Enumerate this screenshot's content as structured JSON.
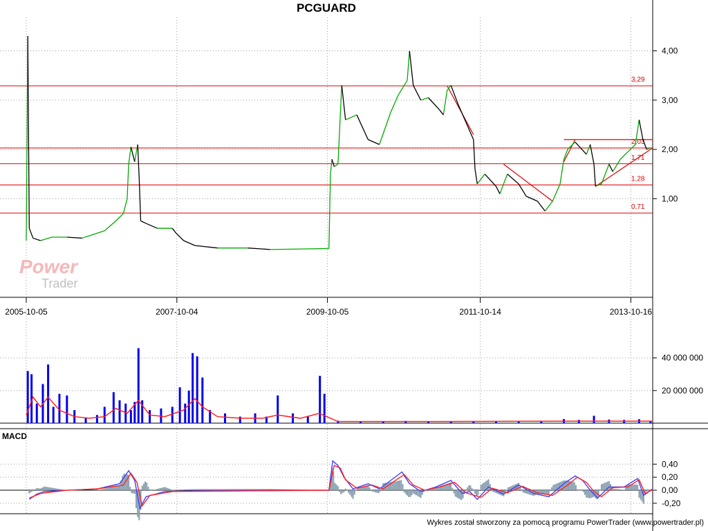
{
  "chart_data": [
    {
      "type": "line",
      "title": "PCGUARD",
      "x_tick_labels": [
        "2005-10-05",
        "2007-10-04",
        "2009-10-05",
        "2011-10-14",
        "2013-10-16"
      ],
      "x_tick_years": [
        2005.76,
        2007.76,
        2009.76,
        2011.79,
        2013.79
      ],
      "x_range": [
        2005.76,
        2014.08
      ],
      "y_ticks": [
        1,
        2,
        3,
        4
      ],
      "y_tick_labels": [
        "1,00",
        "2,00",
        "3,00",
        "4,00"
      ],
      "ylim": [
        -1.0,
        4.4
      ],
      "grid": true,
      "price_color": "#000000",
      "up_color": "#00aa00",
      "level_color": "#dd0000",
      "levels": [
        {
          "value": 3.29,
          "label": "3,29"
        },
        {
          "value": 2.03,
          "label": "2,03"
        },
        {
          "value": 1.71,
          "label": "1,71"
        },
        {
          "value": 1.28,
          "label": "1,28"
        },
        {
          "value": 0.71,
          "label": "0,71"
        }
      ],
      "series": [
        {
          "values": [
            [
              2005.76,
              0.15
            ],
            [
              2005.78,
              4.3
            ],
            [
              2005.8,
              0.4
            ],
            [
              2005.85,
              0.2
            ],
            [
              2005.95,
              0.15
            ],
            [
              2006.1,
              0.22
            ],
            [
              2006.3,
              0.22
            ],
            [
              2006.5,
              0.2
            ],
            [
              2006.6,
              0.25
            ],
            [
              2006.8,
              0.35
            ],
            [
              2006.95,
              0.55
            ],
            [
              2007.05,
              0.7
            ],
            [
              2007.1,
              1.0
            ],
            [
              2007.12,
              1.7
            ],
            [
              2007.15,
              2.05
            ],
            [
              2007.2,
              1.75
            ],
            [
              2007.24,
              2.1
            ],
            [
              2007.26,
              1.4
            ],
            [
              2007.28,
              0.55
            ],
            [
              2007.35,
              0.5
            ],
            [
              2007.5,
              0.4
            ],
            [
              2007.7,
              0.4
            ],
            [
              2007.75,
              0.3
            ],
            [
              2007.85,
              0.15
            ],
            [
              2008.0,
              0.05
            ],
            [
              2008.3,
              0.0
            ],
            [
              2008.7,
              0.0
            ],
            [
              2009.0,
              -0.03
            ],
            [
              2009.4,
              -0.02
            ],
            [
              2009.78,
              -0.01
            ],
            [
              2009.8,
              1.5
            ],
            [
              2009.82,
              1.8
            ],
            [
              2009.85,
              1.65
            ],
            [
              2009.9,
              1.7
            ],
            [
              2009.95,
              3.3
            ],
            [
              2010.0,
              2.6
            ],
            [
              2010.15,
              2.7
            ],
            [
              2010.3,
              2.2
            ],
            [
              2010.45,
              2.1
            ],
            [
              2010.6,
              2.75
            ],
            [
              2010.7,
              3.1
            ],
            [
              2010.82,
              3.4
            ],
            [
              2010.85,
              4.0
            ],
            [
              2010.9,
              3.3
            ],
            [
              2011.0,
              3.0
            ],
            [
              2011.1,
              3.05
            ],
            [
              2011.25,
              2.8
            ],
            [
              2011.3,
              2.7
            ],
            [
              2011.35,
              3.2
            ],
            [
              2011.4,
              3.3
            ],
            [
              2011.5,
              2.9
            ],
            [
              2011.6,
              2.55
            ],
            [
              2011.7,
              2.2
            ],
            [
              2011.72,
              1.6
            ],
            [
              2011.75,
              1.3
            ],
            [
              2011.85,
              1.5
            ],
            [
              2012.0,
              1.25
            ],
            [
              2012.05,
              1.1
            ],
            [
              2012.15,
              1.5
            ],
            [
              2012.3,
              1.3
            ],
            [
              2012.4,
              1.05
            ],
            [
              2012.55,
              0.95
            ],
            [
              2012.65,
              0.75
            ],
            [
              2012.75,
              0.95
            ],
            [
              2012.85,
              1.3
            ],
            [
              2012.9,
              1.8
            ],
            [
              2012.95,
              2.0
            ],
            [
              2013.05,
              2.15
            ],
            [
              2013.2,
              1.9
            ],
            [
              2013.25,
              2.1
            ],
            [
              2013.3,
              1.7
            ],
            [
              2013.32,
              1.25
            ],
            [
              2013.4,
              1.3
            ],
            [
              2013.5,
              1.7
            ],
            [
              2013.55,
              1.55
            ],
            [
              2013.65,
              1.8
            ],
            [
              2013.75,
              1.95
            ],
            [
              2013.85,
              2.1
            ],
            [
              2013.9,
              2.6
            ],
            [
              2013.95,
              2.2
            ],
            [
              2014.0,
              2.0
            ],
            [
              2014.05,
              2.03
            ]
          ]
        }
      ],
      "trend_lines": [
        [
          [
            2011.35,
            3.29
          ],
          [
            2011.7,
            2.3
          ]
        ],
        [
          [
            2012.1,
            1.7
          ],
          [
            2012.75,
            0.95
          ]
        ],
        [
          [
            2012.9,
            1.75
          ],
          [
            2013.05,
            2.2
          ]
        ],
        [
          [
            2013.35,
            1.28
          ],
          [
            2014.08,
            2.03
          ]
        ],
        [
          [
            2012.9,
            2.2
          ],
          [
            2014.08,
            2.2
          ]
        ]
      ]
    },
    {
      "type": "bar",
      "name": "volume",
      "y_ticks": [
        20000000,
        40000000
      ],
      "y_tick_labels": [
        "20 000 000",
        "40 000 000"
      ],
      "ylim": [
        0,
        56000000
      ],
      "bar_color": "#0000ee",
      "avg_color": "#ff2020",
      "bars": [
        [
          2005.78,
          32000000
        ],
        [
          2005.83,
          30000000
        ],
        [
          2005.9,
          12000000
        ],
        [
          2005.98,
          24000000
        ],
        [
          2006.05,
          36000000
        ],
        [
          2006.12,
          10000000
        ],
        [
          2006.2,
          18000000
        ],
        [
          2006.3,
          17000000
        ],
        [
          2006.4,
          8000000
        ],
        [
          2006.55,
          3000000
        ],
        [
          2006.7,
          5000000
        ],
        [
          2006.8,
          10000000
        ],
        [
          2006.92,
          19000000
        ],
        [
          2007.0,
          14000000
        ],
        [
          2007.08,
          12000000
        ],
        [
          2007.15,
          8000000
        ],
        [
          2007.2,
          13000000
        ],
        [
          2007.25,
          46000000
        ],
        [
          2007.3,
          14000000
        ],
        [
          2007.4,
          8000000
        ],
        [
          2007.55,
          9000000
        ],
        [
          2007.7,
          10000000
        ],
        [
          2007.8,
          22000000
        ],
        [
          2007.87,
          12000000
        ],
        [
          2007.92,
          20000000
        ],
        [
          2007.97,
          43000000
        ],
        [
          2008.03,
          41000000
        ],
        [
          2008.1,
          28000000
        ],
        [
          2008.2,
          8000000
        ],
        [
          2008.4,
          6000000
        ],
        [
          2008.6,
          4000000
        ],
        [
          2008.8,
          6000000
        ],
        [
          2008.95,
          4000000
        ],
        [
          2009.1,
          17000000
        ],
        [
          2009.3,
          6000000
        ],
        [
          2009.5,
          4000000
        ],
        [
          2009.66,
          29000000
        ],
        [
          2009.72,
          18000000
        ],
        [
          2009.9,
          1500000
        ],
        [
          2010.2,
          1200000
        ],
        [
          2010.5,
          1000000
        ],
        [
          2010.8,
          1400000
        ],
        [
          2011.1,
          1000000
        ],
        [
          2011.4,
          900000
        ],
        [
          2011.7,
          1000000
        ],
        [
          2012.0,
          1200000
        ],
        [
          2012.3,
          1000000
        ],
        [
          2012.6,
          1300000
        ],
        [
          2012.9,
          2500000
        ],
        [
          2013.1,
          2000000
        ],
        [
          2013.3,
          4500000
        ],
        [
          2013.5,
          2200000
        ],
        [
          2013.7,
          2000000
        ],
        [
          2013.9,
          2400000
        ],
        [
          2014.05,
          1500000
        ]
      ],
      "moving_average": [
        [
          2005.76,
          5000000
        ],
        [
          2005.85,
          16000000
        ],
        [
          2005.95,
          10000000
        ],
        [
          2006.05,
          16000000
        ],
        [
          2006.2,
          8000000
        ],
        [
          2006.4,
          4000000
        ],
        [
          2006.6,
          3000000
        ],
        [
          2006.8,
          4000000
        ],
        [
          2006.95,
          9000000
        ],
        [
          2007.1,
          6000000
        ],
        [
          2007.25,
          14000000
        ],
        [
          2007.4,
          5000000
        ],
        [
          2007.6,
          4000000
        ],
        [
          2007.85,
          8000000
        ],
        [
          2008.0,
          15000000
        ],
        [
          2008.1,
          10000000
        ],
        [
          2008.3,
          4000000
        ],
        [
          2008.6,
          3000000
        ],
        [
          2008.9,
          3000000
        ],
        [
          2009.1,
          5000000
        ],
        [
          2009.4,
          3000000
        ],
        [
          2009.65,
          6000000
        ],
        [
          2009.75,
          4000000
        ],
        [
          2009.9,
          1000000
        ],
        [
          2011.0,
          1000000
        ],
        [
          2013.0,
          1200000
        ],
        [
          2014.08,
          1200000
        ]
      ]
    },
    {
      "type": "line",
      "name": "MACD",
      "title": "MACD",
      "y_ticks": [
        -0.2,
        0,
        0.2,
        0.4
      ],
      "y_tick_labels": [
        "-0,20",
        "0,00",
        "0,20",
        "0,40"
      ],
      "ylim": [
        -0.35,
        0.52
      ],
      "zero_line": true,
      "hist_color": "#8aa0b0",
      "series": [
        {
          "color": "#4040ff",
          "values": [
            [
              2005.8,
              -0.14
            ],
            [
              2005.9,
              -0.06
            ],
            [
              2006.0,
              -0.02
            ],
            [
              2006.3,
              0.0
            ],
            [
              2006.7,
              0.02
            ],
            [
              2007.0,
              0.1
            ],
            [
              2007.12,
              0.3
            ],
            [
              2007.2,
              0.15
            ],
            [
              2007.27,
              -0.28
            ],
            [
              2007.35,
              -0.1
            ],
            [
              2007.6,
              -0.02
            ],
            [
              2008.0,
              -0.01
            ],
            [
              2009.0,
              0.0
            ],
            [
              2009.78,
              0.0
            ],
            [
              2009.83,
              0.45
            ],
            [
              2009.9,
              0.38
            ],
            [
              2009.98,
              0.2
            ],
            [
              2010.1,
              0.02
            ],
            [
              2010.3,
              0.1
            ],
            [
              2010.45,
              0.02
            ],
            [
              2010.6,
              0.15
            ],
            [
              2010.75,
              0.28
            ],
            [
              2010.85,
              0.1
            ],
            [
              2011.0,
              -0.02
            ],
            [
              2011.2,
              0.05
            ],
            [
              2011.4,
              0.15
            ],
            [
              2011.55,
              -0.05
            ],
            [
              2011.65,
              -0.02
            ],
            [
              2011.75,
              -0.14
            ],
            [
              2011.9,
              0.05
            ],
            [
              2012.1,
              -0.06
            ],
            [
              2012.3,
              0.08
            ],
            [
              2012.5,
              -0.05
            ],
            [
              2012.7,
              -0.1
            ],
            [
              2012.9,
              0.1
            ],
            [
              2013.05,
              0.22
            ],
            [
              2013.15,
              0.15
            ],
            [
              2013.25,
              0.0
            ],
            [
              2013.35,
              -0.12
            ],
            [
              2013.5,
              0.05
            ],
            [
              2013.7,
              0.05
            ],
            [
              2013.88,
              0.18
            ],
            [
              2013.96,
              -0.08
            ],
            [
              2014.08,
              0.02
            ]
          ]
        },
        {
          "color": "#ff2020",
          "values": [
            [
              2005.8,
              -0.12
            ],
            [
              2005.95,
              -0.05
            ],
            [
              2006.3,
              0.0
            ],
            [
              2006.7,
              0.02
            ],
            [
              2007.05,
              0.08
            ],
            [
              2007.15,
              0.26
            ],
            [
              2007.23,
              0.12
            ],
            [
              2007.3,
              -0.24
            ],
            [
              2007.4,
              -0.08
            ],
            [
              2007.7,
              -0.02
            ],
            [
              2009.78,
              0.0
            ],
            [
              2009.85,
              0.38
            ],
            [
              2009.93,
              0.34
            ],
            [
              2010.0,
              0.16
            ],
            [
              2010.15,
              0.03
            ],
            [
              2010.35,
              0.08
            ],
            [
              2010.5,
              0.02
            ],
            [
              2010.65,
              0.14
            ],
            [
              2010.78,
              0.24
            ],
            [
              2010.9,
              0.08
            ],
            [
              2011.05,
              0.0
            ],
            [
              2011.25,
              0.05
            ],
            [
              2011.45,
              0.12
            ],
            [
              2011.6,
              -0.04
            ],
            [
              2011.8,
              -0.11
            ],
            [
              2011.95,
              0.03
            ],
            [
              2012.15,
              -0.04
            ],
            [
              2012.35,
              0.06
            ],
            [
              2012.55,
              -0.04
            ],
            [
              2012.75,
              -0.08
            ],
            [
              2012.95,
              0.08
            ],
            [
              2013.08,
              0.2
            ],
            [
              2013.2,
              0.12
            ],
            [
              2013.3,
              -0.02
            ],
            [
              2013.4,
              -0.1
            ],
            [
              2013.55,
              0.04
            ],
            [
              2013.75,
              0.05
            ],
            [
              2013.9,
              0.16
            ],
            [
              2013.98,
              -0.05
            ],
            [
              2014.08,
              0.01
            ]
          ]
        }
      ]
    }
  ],
  "footer": "Wykres został stworzony za pomocą programu PowerTrader (www.powertrader.pl)",
  "watermark": {
    "line1": "Power",
    "line2": "Trader"
  }
}
